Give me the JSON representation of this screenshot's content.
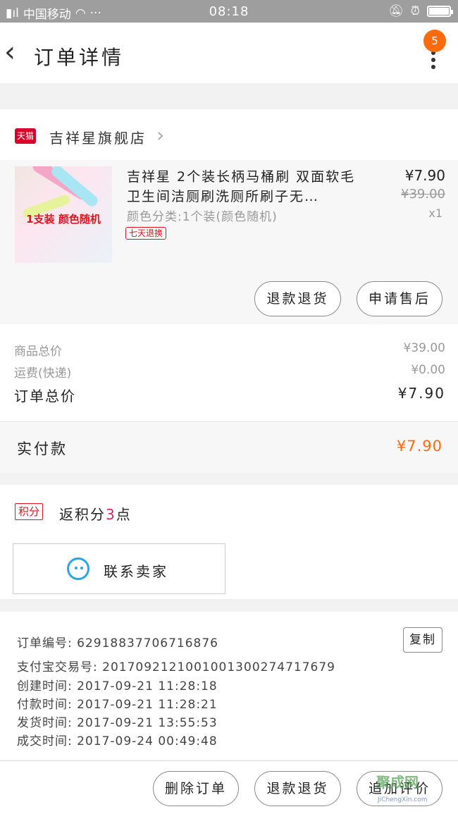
{
  "statusbar": {
    "carrier": "中国移动",
    "signal": "ul",
    "dots": "···",
    "time": "08:18"
  },
  "nav": {
    "title": "订单详情",
    "badge": "5"
  },
  "store": {
    "platform_badge": "天猫",
    "name": "吉祥星旗舰店"
  },
  "product": {
    "image_caption": "1支装 颜色随机",
    "title": "吉祥星 2个装长柄马桶刷 双面软毛卫生间洁厕刷洗厕所刷子无…",
    "sku": "颜色分类:1个装(颜色随机)",
    "tag": "七天退换",
    "price": "¥7.90",
    "original_price": "¥39.00",
    "quantity": "x1",
    "buttons": {
      "refund": "退款退货",
      "after_sale": "申请售后"
    }
  },
  "summary": {
    "goods_total_label": "商品总价",
    "goods_total": "¥39.00",
    "shipping_label": "运费(快递)",
    "shipping": "¥0.00",
    "order_total_label": "订单总价",
    "order_total": "¥7.90"
  },
  "payment": {
    "label": "实付款",
    "value": "¥7.90"
  },
  "points": {
    "tag": "积分",
    "prefix": "返积分",
    "count": "3",
    "suffix": "点"
  },
  "contact": {
    "label": "联系卖家"
  },
  "order_info": {
    "order_no": "订单编号: 629188377067​16876",
    "alipay_no": "支付宝交易号: 2017092121001001300274717679",
    "created": "创建时间: 2017-09-21  11:28:18",
    "paid": "付款时间: 2017-09-21  11:28:21",
    "shipped": "发货时间: 2017-09-21  13:55:53",
    "completed": "成交时间: 2017-09-24  00:49:48",
    "copy_label": "复制"
  },
  "bottom_bar": {
    "delete": "删除订单",
    "refund": "退款退货",
    "review": "追加评价"
  },
  "watermark": {
    "text": "聚成网",
    "site": "JiChengXin.com"
  },
  "colors": {
    "accent": "#ff6a0c",
    "tmall_red": "#d8002a",
    "contact_blue": "#2aa7e0"
  }
}
